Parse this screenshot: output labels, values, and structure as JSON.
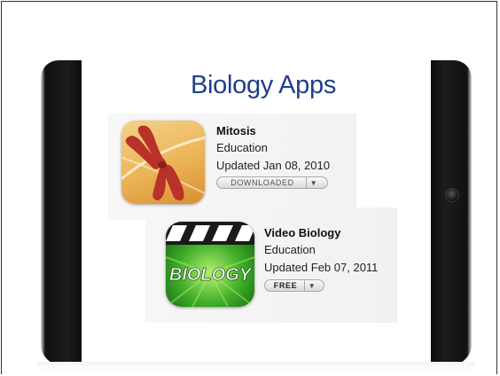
{
  "slide": {
    "title": "Biology Apps"
  },
  "apps": [
    {
      "name": "Mitosis",
      "category": "Education",
      "updated": "Updated Jan 08, 2010",
      "button": "DOWNLOADED",
      "arrow": "▼"
    },
    {
      "name": "Video Biology",
      "category": "Education",
      "updated": "Updated Feb 07, 2011",
      "button": "FREE",
      "arrow": "▼",
      "icon_text": "BIOLOGY"
    }
  ],
  "colors": {
    "title": "#1f3f8a",
    "mitosis_icon_bg": "#ecb357",
    "chromosome": "#b8322a",
    "video_icon_bg": "#3fae2a"
  },
  "icons": [
    "chromosome-icon",
    "clapperboard-icon",
    "home-button-icon"
  ]
}
